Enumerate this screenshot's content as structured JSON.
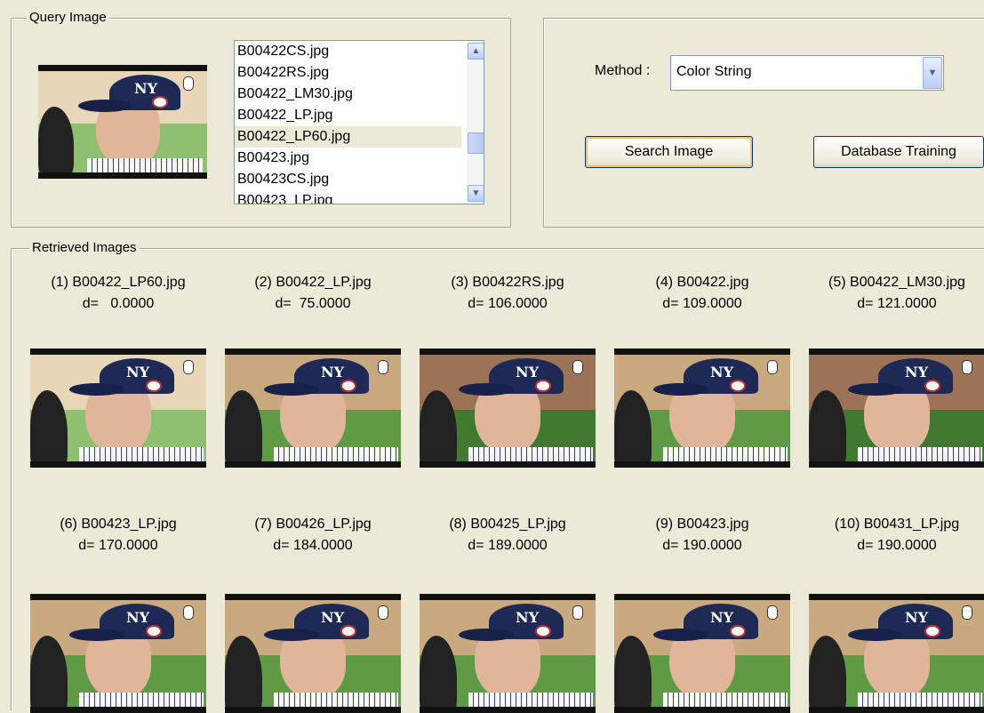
{
  "query_group": {
    "legend": "Query Image",
    "files": [
      "B00422CS.jpg",
      "B00422RS.jpg",
      "B00422_LM30.jpg",
      "B00422_LP.jpg",
      "B00422_LP60.jpg",
      "B00423.jpg",
      "B00423CS.jpg",
      "B00423_LP.jpg"
    ],
    "selected_file": "B00422_LP60.jpg"
  },
  "method": {
    "label": "Method :",
    "selected": "Color String"
  },
  "buttons": {
    "search": "Search Image",
    "train": "Database Training"
  },
  "retrieved_group": {
    "legend": "Retrieved Images",
    "results": [
      {
        "name": "(1) B00422_LP60.jpg",
        "distance": "d=   0.0000"
      },
      {
        "name": "(2) B00422_LP.jpg",
        "distance": "d=  75.0000"
      },
      {
        "name": "(3) B00422RS.jpg",
        "distance": "d= 106.0000"
      },
      {
        "name": "(4) B00422.jpg",
        "distance": "d= 109.0000"
      },
      {
        "name": "(5) B00422_LM30.jpg",
        "distance": "d= 121.0000"
      },
      {
        "name": "(6) B00423_LP.jpg",
        "distance": "d= 170.0000"
      },
      {
        "name": "(7) B00426_LP.jpg",
        "distance": "d= 184.0000"
      },
      {
        "name": "(8) B00425_LP.jpg",
        "distance": "d= 189.0000"
      },
      {
        "name": "(9) B00423.jpg",
        "distance": "d= 190.0000"
      },
      {
        "name": "(10) B00431_LP.jpg",
        "distance": "d= 190.0000"
      }
    ]
  }
}
